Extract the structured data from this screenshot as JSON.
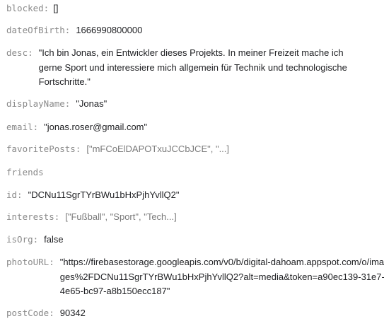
{
  "fields": [
    {
      "key": "blocked:",
      "value": "[]"
    },
    {
      "key": "dateOfBirth:",
      "value": "1666990800000"
    },
    {
      "key": "desc:",
      "value": "\"Ich bin Jonas, ein Entwickler dieses Projekts. In meiner Freizeit mache ich gerne Sport und interessiere mich allgemein für Technik und technologische Fortschritte.\""
    },
    {
      "key": "displayName:",
      "value": "\"Jonas\""
    },
    {
      "key": "email:",
      "value": "\"jonas.roser@gmail.com\""
    },
    {
      "key": "favoritePosts:",
      "value": "[\"mFCoElDAPOTxuJCCbJCE\", \"...]"
    },
    {
      "key": "friends",
      "value": ""
    },
    {
      "key": "id:",
      "value": "\"DCNu11SgrTYrBWu1bHxPjhYvllQ2\""
    },
    {
      "key": "interests:",
      "value": "[\"Fußball\", \"Sport\", \"Tech...]"
    },
    {
      "key": "isOrg:",
      "value": "false"
    },
    {
      "key": "photoURL:",
      "value": "\"https://firebasestorage.googleapis.com/v0/b/digital-dahoam.appspot.com/o/images%2FDCNu11SgrTYrBWu1bHxPjhYvllQ2?alt=media&token=a90ec139-31e7-4e65-bc97-a8b150ecc187\""
    },
    {
      "key": "postCode:",
      "value": "90342"
    }
  ]
}
